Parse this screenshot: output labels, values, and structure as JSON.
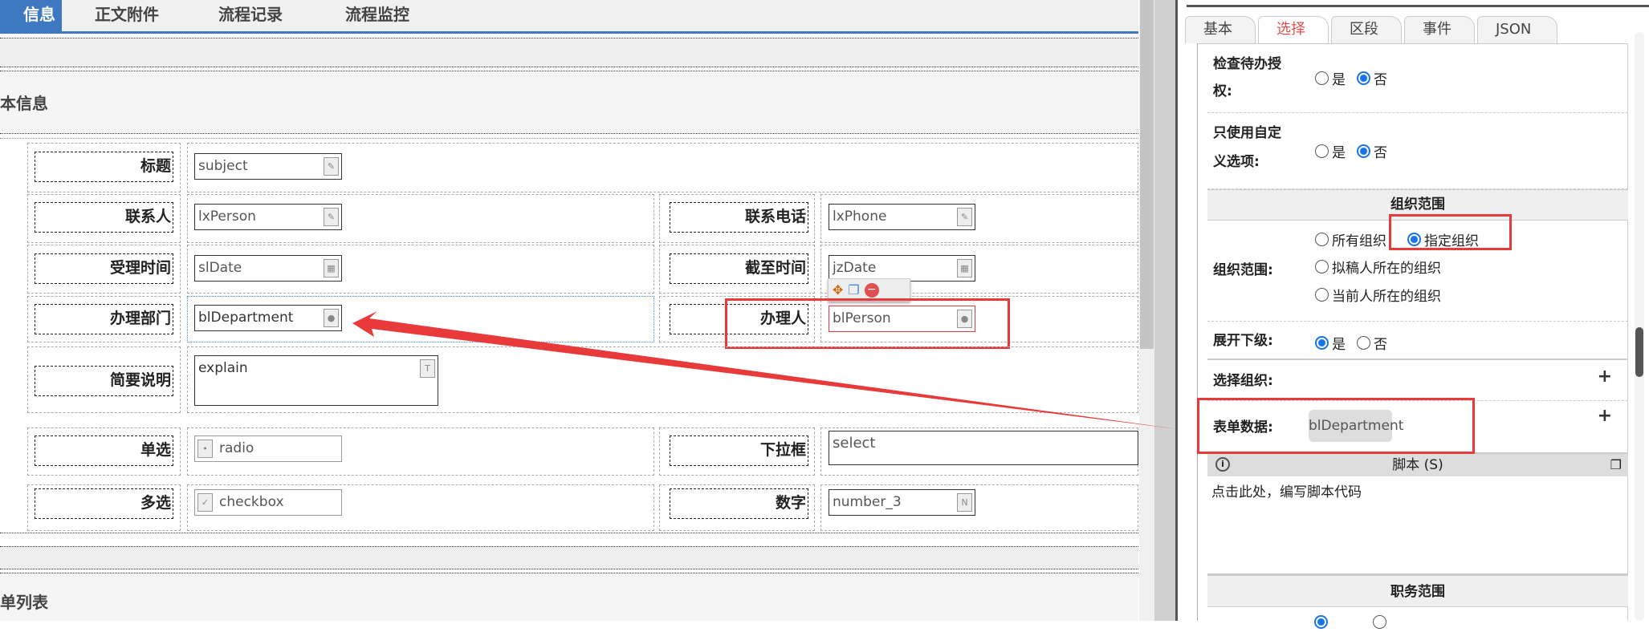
{
  "left_tabs": [
    {
      "label": "信息"
    },
    {
      "label": "正文附件"
    },
    {
      "label": "流程记录"
    },
    {
      "label": "流程监控"
    }
  ],
  "section_title": "本信息",
  "section2_title": "单列表",
  "fields": {
    "subject": {
      "label": "标题",
      "value": "subject"
    },
    "lxPerson": {
      "label": "联系人",
      "value": "lxPerson"
    },
    "lxPhone": {
      "label": "联系电话",
      "value": "lxPhone"
    },
    "slDate": {
      "label": "受理时间",
      "value": "slDate"
    },
    "jzDate": {
      "label": "截至时间",
      "value": "jzDate"
    },
    "blDepartment": {
      "label": "办理部门",
      "value": "blDepartment"
    },
    "blPerson": {
      "label": "办理人",
      "value": "blPerson"
    },
    "explain": {
      "label": "简要说明",
      "value": "explain"
    },
    "radio": {
      "label": "单选",
      "value": "radio"
    },
    "select": {
      "label": "下拉框",
      "value": "select"
    },
    "checkbox": {
      "label": "多选",
      "value": "checkbox"
    },
    "number": {
      "label": "数字",
      "value": "number_3"
    }
  },
  "right_tabs": [
    {
      "label": "基本"
    },
    {
      "label": "选择"
    },
    {
      "label": "区段"
    },
    {
      "label": "事件"
    },
    {
      "label": "JSON"
    }
  ],
  "props": {
    "check_auth": {
      "label1": "检查待办授",
      "label2": "权:",
      "yes": "是",
      "no": "否",
      "selected": "否"
    },
    "custom_only": {
      "label1": "只使用自定",
      "label2": "义选项:",
      "yes": "是",
      "no": "否",
      "selected": "否"
    },
    "org_section": "组织范围",
    "org_scope": {
      "label": "组织范围:",
      "options": [
        "所有组织",
        "指定组织",
        "拟稿人所在的组织",
        "当前人所在的组织"
      ],
      "selected": "指定组织"
    },
    "expand": {
      "label": "展开下级:",
      "yes": "是",
      "no": "否",
      "selected": "是"
    },
    "select_org": {
      "label": "选择组织:"
    },
    "form_data": {
      "label": "表单数据:",
      "chip": "blDepartment"
    },
    "script": {
      "title": "脚本 (S)",
      "placeholder": "点击此处，编写脚本代码"
    },
    "duty_section": "职务范围"
  },
  "colors": {
    "accent": "#3e78c0",
    "annotation": "#e83a3a",
    "radio": "#1a73e8"
  }
}
